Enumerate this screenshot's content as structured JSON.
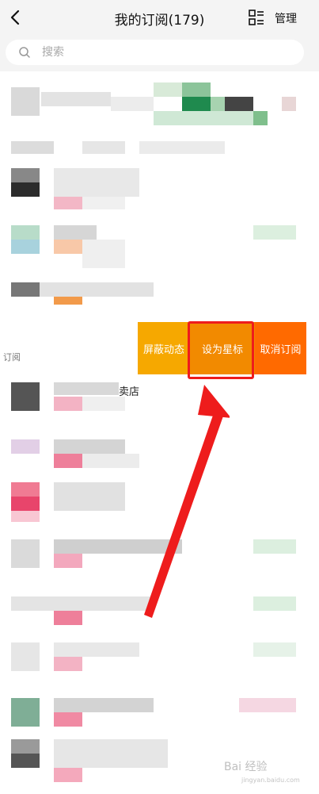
{
  "header": {
    "title": "我的订阅(179)",
    "manage_label": "管理"
  },
  "search": {
    "placeholder": "搜索"
  },
  "section": {
    "label": "订阅"
  },
  "swipe_actions": {
    "block_label": "屏蔽动态",
    "star_label": "设为星标",
    "unsubscribe_label": "取消订阅"
  },
  "partial_texts": {
    "store_fragment": "卖店"
  },
  "watermark": {
    "text": "Bai 经验",
    "sub": "jingyan.baidu.com"
  },
  "colors": {
    "header_bg": "#f4f4f4",
    "action_block": "#f6a800",
    "action_star": "#f28a00",
    "action_unsubscribe": "#ff6a00",
    "highlight": "#ee1c1c"
  }
}
